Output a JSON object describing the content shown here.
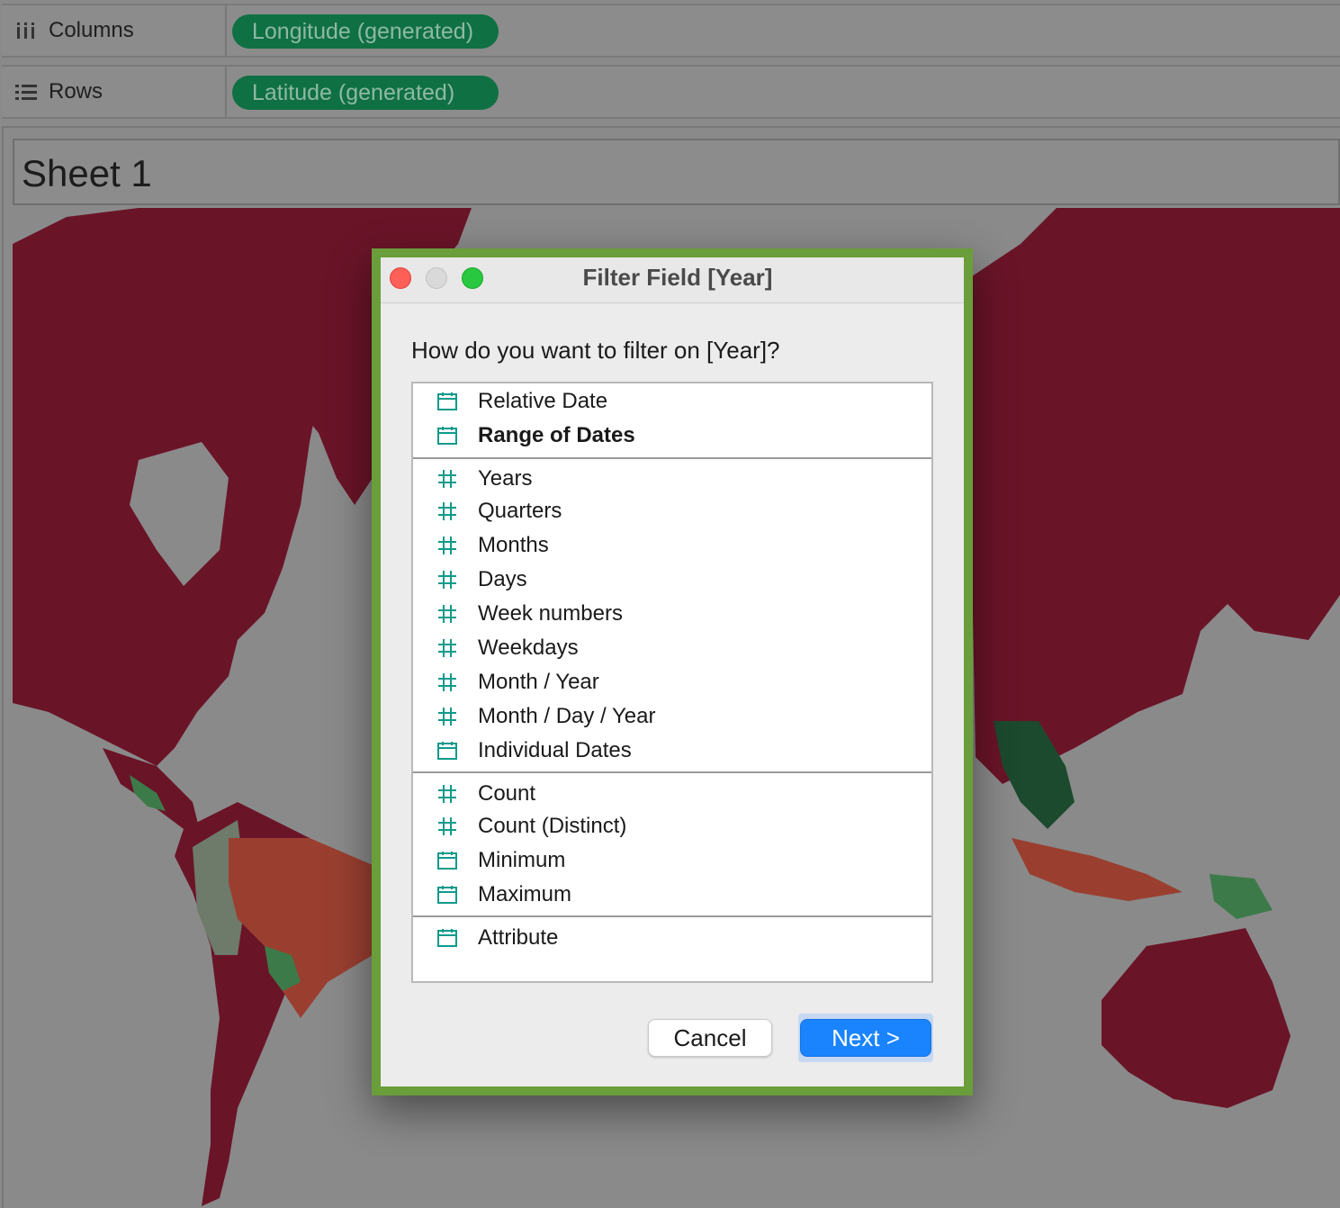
{
  "shelves": {
    "columns": {
      "label": "Columns",
      "pill": "Longitude (generated)"
    },
    "rows": {
      "label": "Rows",
      "pill": "Latitude (generated)"
    }
  },
  "sheet": {
    "title": "Sheet 1"
  },
  "dialog": {
    "title": "Filter Field [Year]",
    "question": "How do you want to filter on [Year]?",
    "items": [
      {
        "label": "Relative Date",
        "icon": "calendar-icon"
      },
      {
        "label": "Range of Dates",
        "icon": "calendar-icon",
        "selected": true
      },
      {
        "label": "Years",
        "icon": "hash-icon"
      },
      {
        "label": "Quarters",
        "icon": "hash-icon"
      },
      {
        "label": "Months",
        "icon": "hash-icon"
      },
      {
        "label": "Days",
        "icon": "hash-icon"
      },
      {
        "label": "Week numbers",
        "icon": "hash-icon"
      },
      {
        "label": "Weekdays",
        "icon": "hash-icon"
      },
      {
        "label": "Month / Year",
        "icon": "hash-icon"
      },
      {
        "label": "Month / Day / Year",
        "icon": "hash-icon"
      },
      {
        "label": "Individual Dates",
        "icon": "calendar-icon"
      },
      {
        "label": "Count",
        "icon": "hash-icon"
      },
      {
        "label": "Count (Distinct)",
        "icon": "hash-icon"
      },
      {
        "label": "Minimum",
        "icon": "calendar-icon"
      },
      {
        "label": "Maximum",
        "icon": "calendar-icon"
      },
      {
        "label": "Attribute",
        "icon": "calendar-icon"
      }
    ],
    "cancel_label": "Cancel",
    "next_label": "Next >"
  },
  "colors": {
    "map_red": "#6a1428",
    "map_dark_green": "#1c4a2e",
    "map_green": "#3d7a4a",
    "map_gray_green": "#6e7a6a",
    "map_orange": "#9a3f30",
    "pill_green": "#0f7043",
    "icon_teal": "#0f9a8a",
    "dialog_border": "#6a9e3a",
    "next_blue": "#1a84ff"
  }
}
